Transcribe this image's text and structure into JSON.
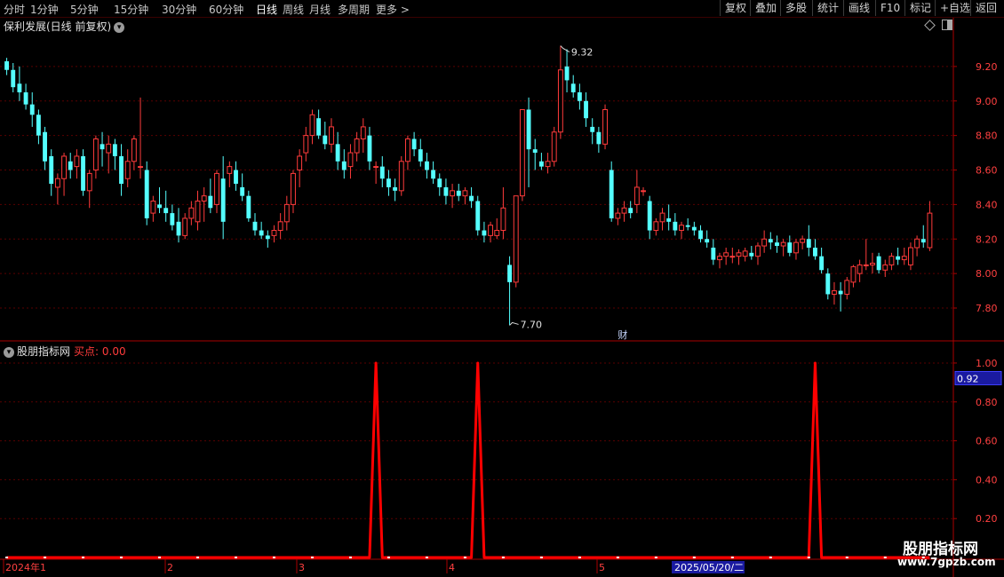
{
  "toolbar": {
    "periods": [
      "分时",
      "1分钟",
      "5分钟",
      "15分钟",
      "30分钟",
      "60分钟",
      "日线",
      "周线",
      "月线",
      "多周期",
      "更多 >"
    ],
    "active_period": "日线",
    "right_buttons": [
      "复权",
      "叠加",
      "多股",
      "统计",
      "画线",
      "F10",
      "标记",
      "+自选",
      "返回"
    ]
  },
  "main": {
    "title": "保利发展(日线 前复权)",
    "high_label": "9.32",
    "low_label": "7.70",
    "event_marker": "财"
  },
  "indicator": {
    "name": "股朋指标网",
    "buy_label": "买点: 0.00",
    "current_value_label": "0.92"
  },
  "xaxis": {
    "labels": [
      "2024年1",
      "2",
      "3",
      "4",
      "5"
    ],
    "cursor_date": "2025/05/20/二"
  },
  "watermark": {
    "line1": "股朋指标网",
    "line2": "www.7gpzb.com"
  },
  "colors": {
    "up": "#ff3b3b",
    "down": "#54ffff",
    "signal": "#ff0000",
    "grid": "#5a0000",
    "axis": "#aa0000"
  },
  "chart_data": [
    {
      "type": "candlestick",
      "title": "保利发展(日线 前复权)",
      "ylim": [
        7.62,
        9.4
      ],
      "yticks": [
        7.8,
        8.0,
        8.2,
        8.4,
        8.6,
        8.8,
        9.0,
        9.2
      ],
      "max_label": 9.32,
      "min_label": 7.7,
      "candles": [
        [
          9.23,
          9.25,
          9.15,
          9.18
        ],
        [
          9.18,
          9.22,
          9.05,
          9.08
        ],
        [
          9.1,
          9.2,
          9.0,
          9.05
        ],
        [
          9.05,
          9.1,
          8.95,
          8.98
        ],
        [
          8.98,
          9.05,
          8.85,
          8.92
        ],
        [
          8.92,
          8.95,
          8.75,
          8.8
        ],
        [
          8.82,
          8.85,
          8.6,
          8.65
        ],
        [
          8.68,
          8.72,
          8.45,
          8.52
        ],
        [
          8.5,
          8.58,
          8.4,
          8.55
        ],
        [
          8.55,
          8.7,
          8.45,
          8.68
        ],
        [
          8.65,
          8.7,
          8.55,
          8.6
        ],
        [
          8.62,
          8.72,
          8.55,
          8.68
        ],
        [
          8.68,
          8.72,
          8.45,
          8.48
        ],
        [
          8.48,
          8.6,
          8.38,
          8.58
        ],
        [
          8.6,
          8.8,
          8.55,
          8.78
        ],
        [
          8.75,
          8.82,
          8.62,
          8.72
        ],
        [
          8.7,
          8.8,
          8.58,
          8.75
        ],
        [
          8.75,
          8.78,
          8.6,
          8.68
        ],
        [
          8.68,
          8.75,
          8.45,
          8.52
        ],
        [
          8.55,
          8.72,
          8.5,
          8.65
        ],
        [
          8.65,
          8.8,
          8.6,
          8.78
        ],
        [
          8.62,
          9.02,
          8.55,
          8.62
        ],
        [
          8.6,
          8.65,
          8.28,
          8.32
        ],
        [
          8.35,
          8.45,
          8.3,
          8.42
        ],
        [
          8.4,
          8.5,
          8.35,
          8.38
        ],
        [
          8.38,
          8.48,
          8.3,
          8.35
        ],
        [
          8.35,
          8.4,
          8.25,
          8.28
        ],
        [
          8.3,
          8.38,
          8.18,
          8.22
        ],
        [
          8.22,
          8.35,
          8.2,
          8.32
        ],
        [
          8.32,
          8.42,
          8.28,
          8.38
        ],
        [
          8.3,
          8.48,
          8.25,
          8.42
        ],
        [
          8.42,
          8.5,
          8.3,
          8.45
        ],
        [
          8.45,
          8.55,
          8.35,
          8.38
        ],
        [
          8.4,
          8.6,
          8.35,
          8.58
        ],
        [
          8.55,
          8.68,
          8.2,
          8.3
        ],
        [
          8.58,
          8.65,
          8.5,
          8.62
        ],
        [
          8.6,
          8.65,
          8.48,
          8.52
        ],
        [
          8.5,
          8.58,
          8.42,
          8.45
        ],
        [
          8.45,
          8.48,
          8.3,
          8.32
        ],
        [
          8.3,
          8.35,
          8.22,
          8.25
        ],
        [
          8.25,
          8.3,
          8.2,
          8.22
        ],
        [
          8.22,
          8.25,
          8.15,
          8.2
        ],
        [
          8.22,
          8.28,
          8.18,
          8.25
        ],
        [
          8.25,
          8.35,
          8.2,
          8.3
        ],
        [
          8.3,
          8.45,
          8.25,
          8.4
        ],
        [
          8.4,
          8.6,
          8.35,
          8.58
        ],
        [
          8.6,
          8.72,
          8.5,
          8.68
        ],
        [
          8.7,
          8.85,
          8.65,
          8.8
        ],
        [
          8.8,
          8.95,
          8.75,
          8.92
        ],
        [
          8.9,
          8.95,
          8.78,
          8.8
        ],
        [
          8.8,
          8.88,
          8.72,
          8.75
        ],
        [
          8.75,
          8.9,
          8.7,
          8.85
        ],
        [
          8.75,
          8.82,
          8.6,
          8.65
        ],
        [
          8.65,
          8.72,
          8.55,
          8.6
        ],
        [
          8.62,
          8.75,
          8.55,
          8.7
        ],
        [
          8.7,
          8.82,
          8.65,
          8.78
        ],
        [
          8.78,
          8.9,
          8.7,
          8.85
        ],
        [
          8.8,
          8.85,
          8.6,
          8.65
        ],
        [
          8.62,
          8.65,
          8.52,
          8.62
        ],
        [
          8.62,
          8.68,
          8.5,
          8.55
        ],
        [
          8.55,
          8.6,
          8.45,
          8.5
        ],
        [
          8.5,
          8.55,
          8.42,
          8.48
        ],
        [
          8.48,
          8.68,
          8.45,
          8.65
        ],
        [
          8.65,
          8.8,
          8.6,
          8.78
        ],
        [
          8.78,
          8.82,
          8.68,
          8.72
        ],
        [
          8.72,
          8.78,
          8.62,
          8.65
        ],
        [
          8.65,
          8.7,
          8.55,
          8.6
        ],
        [
          8.6,
          8.65,
          8.52,
          8.55
        ],
        [
          8.55,
          8.58,
          8.45,
          8.5
        ],
        [
          8.5,
          8.55,
          8.4,
          8.45
        ],
        [
          8.45,
          8.52,
          8.38,
          8.48
        ],
        [
          8.48,
          8.52,
          8.42,
          8.45
        ],
        [
          8.45,
          8.5,
          8.4,
          8.48
        ],
        [
          8.45,
          8.5,
          8.38,
          8.42
        ],
        [
          8.42,
          8.45,
          8.22,
          8.25
        ],
        [
          8.25,
          8.3,
          8.18,
          8.22
        ],
        [
          8.22,
          8.3,
          8.18,
          8.28
        ],
        [
          8.22,
          8.32,
          8.2,
          8.25
        ],
        [
          8.25,
          8.5,
          8.2,
          8.38
        ],
        [
          8.05,
          8.1,
          7.7,
          7.95
        ],
        [
          7.95,
          8.45,
          7.92,
          8.45
        ],
        [
          8.45,
          8.9,
          8.42,
          8.95
        ],
        [
          8.95,
          9.02,
          8.5,
          8.72
        ],
        [
          8.72,
          8.78,
          8.6,
          8.7
        ],
        [
          8.65,
          8.7,
          8.6,
          8.62
        ],
        [
          8.62,
          8.7,
          8.58,
          8.65
        ],
        [
          8.65,
          8.85,
          8.62,
          8.82
        ],
        [
          8.82,
          9.32,
          8.78,
          9.18
        ],
        [
          9.2,
          9.3,
          9.05,
          9.12
        ],
        [
          9.1,
          9.15,
          9.02,
          9.05
        ],
        [
          9.05,
          9.1,
          8.95,
          9.0
        ],
        [
          9.0,
          9.05,
          8.85,
          8.9
        ],
        [
          8.85,
          8.9,
          8.75,
          8.82
        ],
        [
          8.82,
          8.85,
          8.7,
          8.75
        ],
        [
          8.75,
          8.98,
          8.72,
          8.95
        ],
        [
          8.6,
          8.65,
          8.3,
          8.32
        ],
        [
          8.32,
          8.38,
          8.28,
          8.35
        ],
        [
          8.35,
          8.42,
          8.3,
          8.38
        ],
        [
          8.38,
          8.42,
          8.32,
          8.35
        ],
        [
          8.4,
          8.6,
          8.35,
          8.5
        ],
        [
          8.48,
          8.5,
          8.45,
          8.48
        ],
        [
          8.42,
          8.45,
          8.2,
          8.25
        ],
        [
          8.25,
          8.32,
          8.22,
          8.3
        ],
        [
          8.3,
          8.38,
          8.25,
          8.35
        ],
        [
          8.32,
          8.4,
          8.25,
          8.3
        ],
        [
          8.3,
          8.35,
          8.22,
          8.25
        ],
        [
          8.25,
          8.3,
          8.2,
          8.28
        ],
        [
          8.28,
          8.32,
          8.25,
          8.27
        ],
        [
          8.27,
          8.3,
          8.22,
          8.25
        ],
        [
          8.25,
          8.28,
          8.18,
          8.2
        ],
        [
          8.2,
          8.25,
          8.15,
          8.18
        ],
        [
          8.15,
          8.2,
          8.05,
          8.08
        ],
        [
          8.08,
          8.12,
          8.03,
          8.1
        ],
        [
          8.1,
          8.15,
          8.05,
          8.12
        ],
        [
          8.1,
          8.15,
          8.06,
          8.1
        ],
        [
          8.1,
          8.14,
          8.05,
          8.12
        ],
        [
          8.1,
          8.15,
          8.07,
          8.13
        ],
        [
          8.12,
          8.16,
          8.08,
          8.1
        ],
        [
          8.1,
          8.18,
          8.05,
          8.16
        ],
        [
          8.16,
          8.25,
          8.12,
          8.2
        ],
        [
          8.2,
          8.24,
          8.14,
          8.18
        ],
        [
          8.18,
          8.22,
          8.12,
          8.16
        ],
        [
          8.16,
          8.2,
          8.1,
          8.18
        ],
        [
          8.18,
          8.22,
          8.1,
          8.12
        ],
        [
          8.12,
          8.2,
          8.08,
          8.18
        ],
        [
          8.18,
          8.22,
          8.14,
          8.2
        ],
        [
          8.2,
          8.28,
          8.1,
          8.15
        ],
        [
          8.15,
          8.2,
          8.08,
          8.1
        ],
        [
          8.1,
          8.15,
          8.0,
          8.02
        ],
        [
          8.0,
          8.03,
          7.85,
          7.88
        ],
        [
          7.88,
          7.95,
          7.82,
          7.9
        ],
        [
          7.9,
          7.95,
          7.78,
          7.88
        ],
        [
          7.88,
          7.98,
          7.85,
          7.96
        ],
        [
          7.95,
          8.05,
          7.92,
          8.04
        ],
        [
          8.0,
          8.08,
          7.95,
          8.05
        ],
        [
          8.05,
          8.2,
          8.02,
          8.05
        ],
        [
          8.05,
          8.12,
          8.0,
          8.06
        ],
        [
          8.1,
          8.12,
          8.0,
          8.02
        ],
        [
          8.02,
          8.08,
          7.98,
          8.05
        ],
        [
          8.05,
          8.12,
          8.02,
          8.1
        ],
        [
          8.1,
          8.15,
          8.05,
          8.08
        ],
        [
          8.08,
          8.15,
          8.05,
          8.1
        ],
        [
          8.05,
          8.18,
          8.02,
          8.15
        ],
        [
          8.15,
          8.22,
          8.1,
          8.2
        ],
        [
          8.2,
          8.28,
          8.15,
          8.18
        ],
        [
          8.15,
          8.42,
          8.13,
          8.35
        ]
      ]
    },
    {
      "type": "line",
      "title": "股朋指标网",
      "ylim": [
        0,
        1.05
      ],
      "yticks": [
        0.2,
        0.4,
        0.6,
        0.8,
        1.0
      ],
      "series": [
        {
          "name": "买点",
          "spikes_at_index": [
            58,
            74,
            127
          ],
          "spike_value": 1.0,
          "baseline_value": 0.0
        }
      ],
      "current_value": 0.92
    }
  ]
}
